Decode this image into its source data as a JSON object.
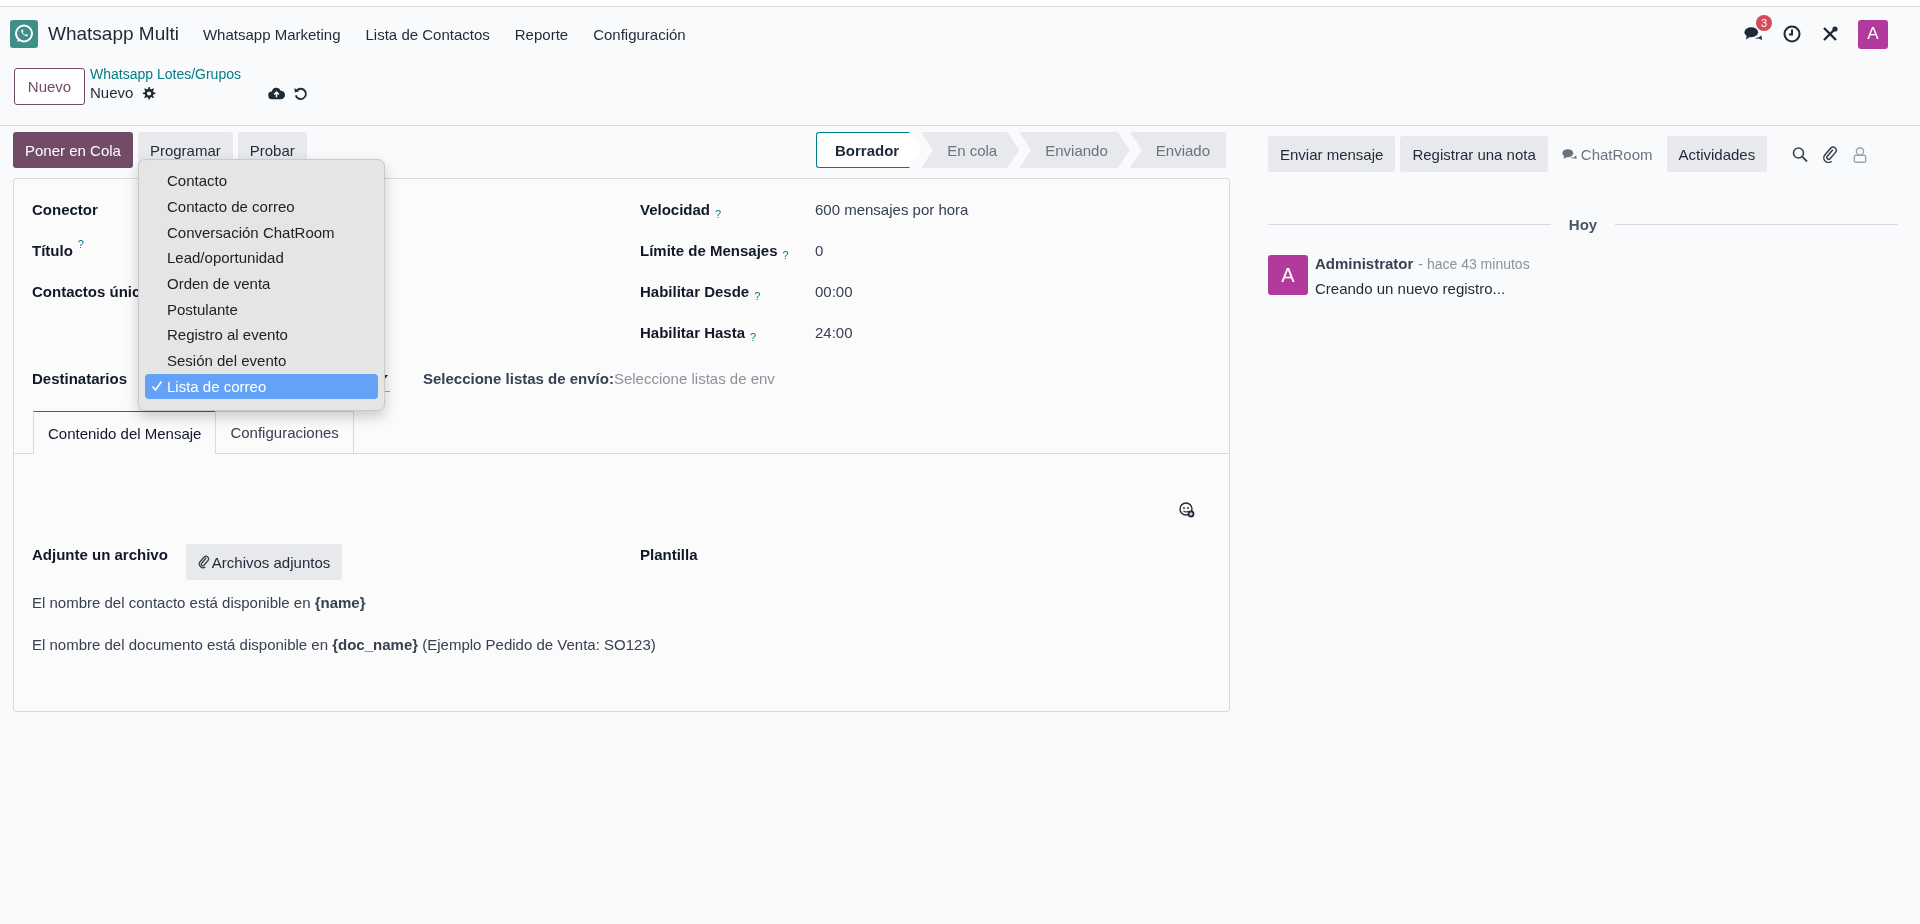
{
  "navbar": {
    "app_name": "Whatsapp Multi",
    "menu": [
      "Whatsapp Marketing",
      "Lista de Contactos",
      "Reporte",
      "Configuración"
    ],
    "messages_badge": "3",
    "avatar": "A"
  },
  "control_panel": {
    "new_button": "Nuevo",
    "breadcrumb": "Whatsapp Lotes/Grupos",
    "record": "Nuevo"
  },
  "actions": [
    {
      "label": "Poner en Cola",
      "kind": "primary"
    },
    {
      "label": "Programar",
      "kind": "secondary"
    },
    {
      "label": "Probar",
      "kind": "secondary"
    }
  ],
  "statusbar": [
    {
      "label": "Borrador",
      "selected": true
    },
    {
      "label": "En cola",
      "selected": false
    },
    {
      "label": "Enviando",
      "selected": false
    },
    {
      "label": "Enviado",
      "selected": false
    }
  ],
  "form": {
    "left_fields": [
      {
        "label": "Conector"
      },
      {
        "label": "Título",
        "help": "?"
      },
      {
        "label": "Contactos únic"
      }
    ],
    "right_fields": [
      {
        "label": "Velocidad",
        "help": "?",
        "value": "600 mensajes por hora"
      },
      {
        "label": "Límite de Mensajes",
        "help": "?",
        "value": "0"
      },
      {
        "label": "Habilitar Desde",
        "help": "?",
        "value": "00:00"
      },
      {
        "label": "Habilitar Hasta",
        "help": "?",
        "value": "24:00"
      }
    ],
    "recipients": {
      "label": "Destinatarios",
      "list_label": "Seleccione listas de envío:",
      "placeholder": "Seleccione listas de env"
    },
    "tabs": [
      {
        "label": "Contenido del Mensaje",
        "selected": true
      },
      {
        "label": "Configuraciones",
        "selected": false
      }
    ],
    "attach_label": "Adjunte un archivo",
    "attach_button": "Archivos adjuntos",
    "template_label": "Plantilla",
    "notes": [
      "El nombre del contacto está disponible en **{name}**",
      "El nombre del documento está disponible en **{doc_name}** (Ejemplo Pedido de Venta: SO123)"
    ]
  },
  "dropdown": {
    "options": [
      {
        "label": "Contacto",
        "selected": false
      },
      {
        "label": "Contacto de correo",
        "selected": false
      },
      {
        "label": "Conversación ChatRoom",
        "selected": false
      },
      {
        "label": "Lead/oportunidad",
        "selected": false
      },
      {
        "label": "Orden de venta",
        "selected": false
      },
      {
        "label": "Postulante",
        "selected": false
      },
      {
        "label": "Registro al evento",
        "selected": false
      },
      {
        "label": "Sesión del evento",
        "selected": false
      },
      {
        "label": "Lista de correo",
        "selected": true
      }
    ]
  },
  "chatter": {
    "buttons": [
      {
        "label": "Enviar mensaje",
        "kind": "button"
      },
      {
        "label": "Registrar una nota",
        "kind": "button"
      },
      {
        "label": "ChatRoom",
        "kind": "link"
      },
      {
        "label": "Actividades",
        "kind": "button"
      }
    ],
    "date_separator": "Hoy",
    "messages": [
      {
        "avatar": "A",
        "author": "Administrator",
        "time": "- hace 43 minutos",
        "body": "Creando un nuevo registro..."
      }
    ]
  }
}
